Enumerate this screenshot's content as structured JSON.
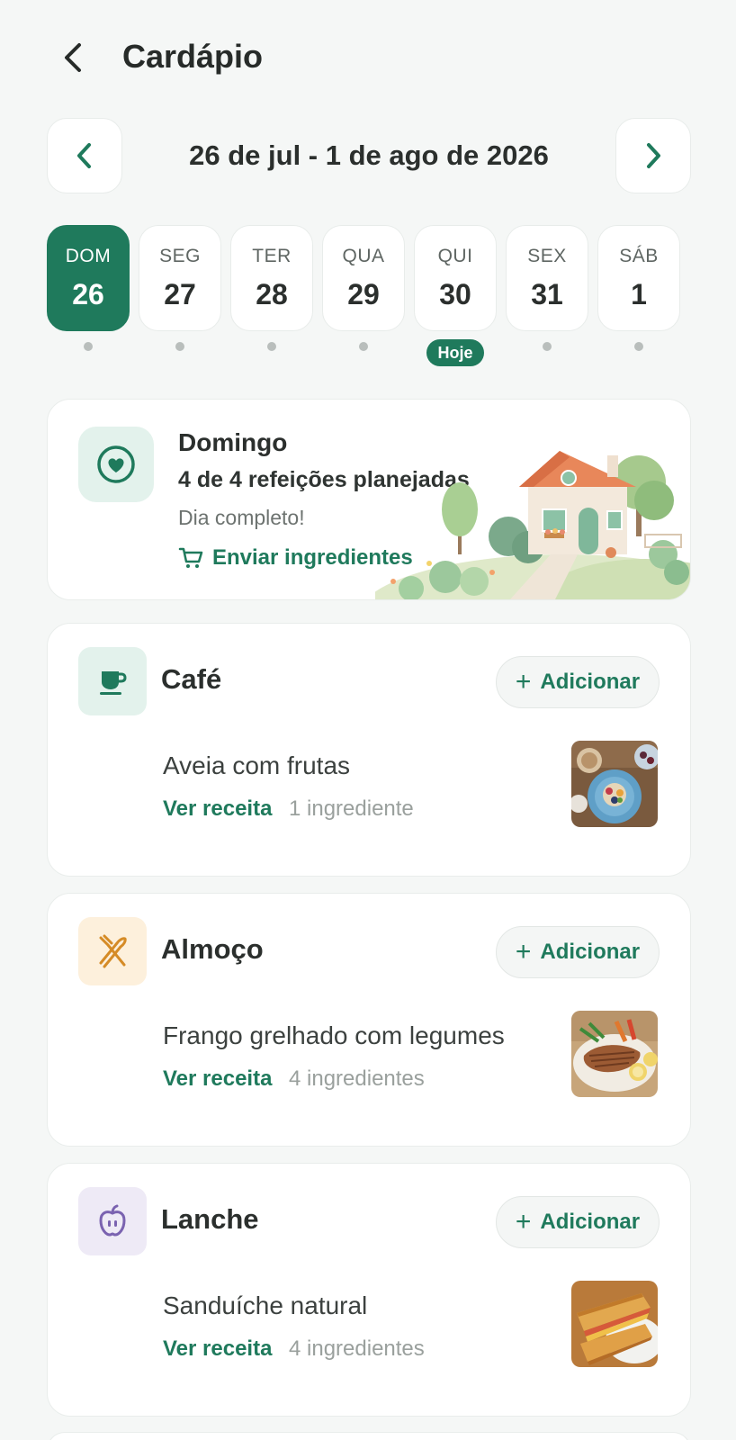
{
  "header": {
    "title": "Cardápio",
    "back_icon": "chevron-left-icon"
  },
  "week": {
    "range": "26 de jul - 1 de ago de 2026",
    "prev_icon": "chevron-left-icon",
    "next_icon": "chevron-right-icon"
  },
  "days": [
    {
      "label": "DOM",
      "num": "26",
      "selected": true
    },
    {
      "label": "SEG",
      "num": "27"
    },
    {
      "label": "TER",
      "num": "28"
    },
    {
      "label": "QUA",
      "num": "29"
    },
    {
      "label": "QUI",
      "num": "30",
      "today": true
    },
    {
      "label": "SEX",
      "num": "31"
    },
    {
      "label": "SÁB",
      "num": "1"
    }
  ],
  "today_badge": "Hoje",
  "summary": {
    "day": "Domingo",
    "meals": "4 de 4 refeições planejadas",
    "status": "Dia completo!",
    "send_ingredients": "Enviar ingredientes",
    "icon": "heart-icon"
  },
  "meals": [
    {
      "name": "Café",
      "add_label": "Adicionar",
      "dish": "Aveia com frutas",
      "see_recipe": "Ver receita",
      "ingredients": "1 ingrediente",
      "icon": "coffee-cup-icon"
    },
    {
      "name": "Almoço",
      "add_label": "Adicionar",
      "dish": "Frango grelhado com legumes",
      "see_recipe": "Ver receita",
      "ingredients": "4 ingredientes",
      "icon": "cutlery-icon"
    },
    {
      "name": "Lanche",
      "add_label": "Adicionar",
      "dish": "Sanduíche natural",
      "see_recipe": "Ver receita",
      "ingredients": "4 ingredientes",
      "icon": "apple-icon"
    }
  ],
  "colors": {
    "accent": "#1f7a5c",
    "background": "#f5f7f6"
  }
}
